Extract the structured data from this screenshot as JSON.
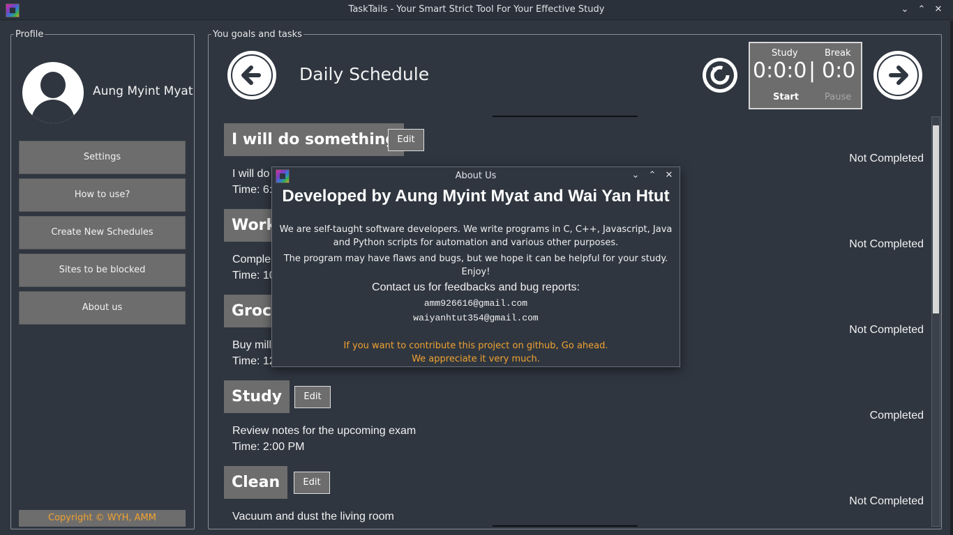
{
  "window": {
    "title": "TaskTails - Your Smart Strict Tool For Your Effective Study",
    "min": "⌄",
    "max": "⌃",
    "close": "✕"
  },
  "profile": {
    "legend": "Profile",
    "name": "Aung Myint Myat",
    "menu": [
      "Settings",
      "How to use?",
      "Create New Schedules",
      "Sites to be blocked",
      "About us"
    ],
    "copyright": "Copyright © WYH, AMM"
  },
  "goals": {
    "legend": "You goals and tasks",
    "title": "Daily Schedule",
    "timer": {
      "study_label": "Study",
      "break_label": "Break",
      "study_value": "0:0:0",
      "separator": "|",
      "break_value": "0:0",
      "start": "Start",
      "pause": "Pause"
    },
    "edit_label": "Edit",
    "tasks": [
      {
        "title": "I will do something",
        "desc": "I will do",
        "time": "Time: 6:",
        "status": "Not Completed"
      },
      {
        "title": "Work",
        "desc": "Comple",
        "time": "Time: 10",
        "status": "Not Completed"
      },
      {
        "title": "Groce",
        "desc": "Buy mill",
        "time": "Time: 12",
        "status": "Not Completed"
      },
      {
        "title": "Study",
        "desc": "Review notes for the upcoming exam",
        "time": "Time: 2:00 PM",
        "status": "Completed"
      },
      {
        "title": "Clean",
        "desc": "Vacuum and dust the living room",
        "time": "",
        "status": "Not Completed"
      }
    ]
  },
  "dialog": {
    "title": "About Us",
    "heading": "Developed by Aung Myint Myat and Wai Yan Htut",
    "para1_line1": "We are self-taught software developers. We write programs in C, C++, Javascript, Java",
    "para1_line2": "and Python scripts for automation and various other purposes.",
    "para2": "The program may have flaws and bugs, but we hope it can be helpful for your study. Enjoy!",
    "contact_heading": "Contact us for feedbacks and bug reports:",
    "email1": "amm926616@gmail.com",
    "email2": "waiyanhtut354@gmail.com",
    "contribute_line1": "If you want to contribute this project on github, Go ahead.",
    "contribute_line2": "We appreciate it very much."
  },
  "colors": {
    "background": "#2f3640",
    "button_gray": "#6d6d6d",
    "accent_orange": "#f0a330"
  }
}
